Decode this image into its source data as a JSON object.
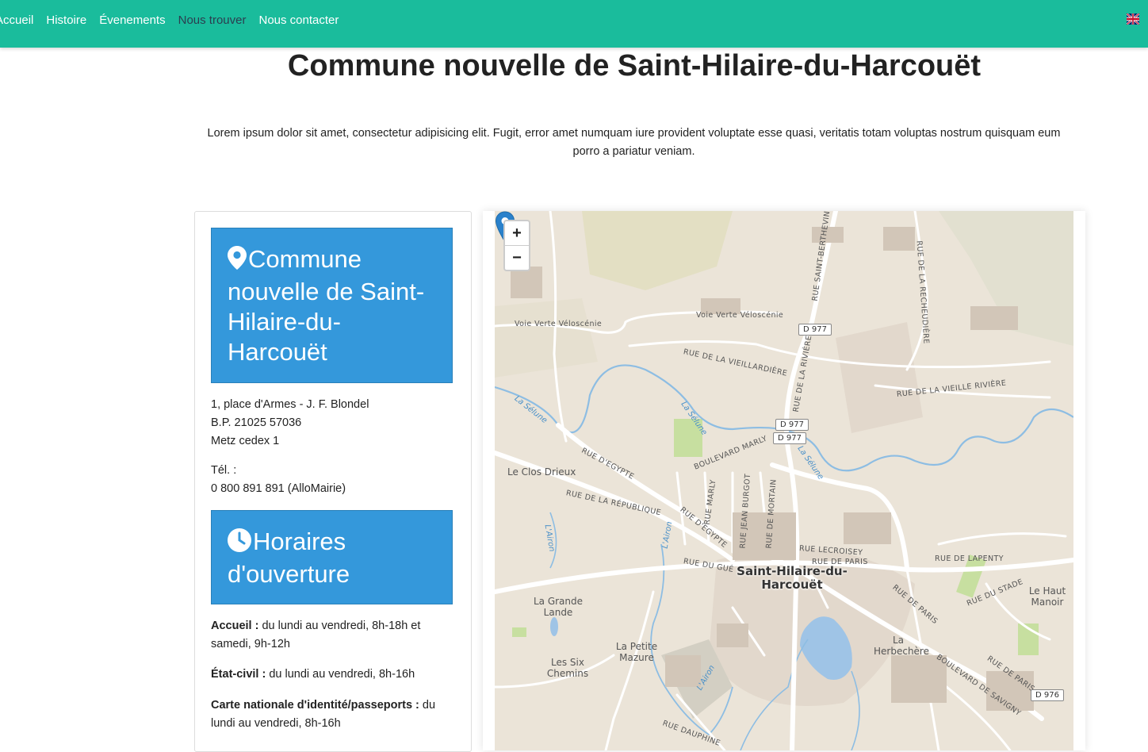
{
  "nav": {
    "items": [
      {
        "label": "Accueil"
      },
      {
        "label": "Histoire"
      },
      {
        "label": "Évenements"
      },
      {
        "label": "Nous trouver"
      },
      {
        "label": "Nous contacter"
      }
    ],
    "active_color": "#2c3e50",
    "bar_color": "#1abc9c",
    "language_flag": "uk-flag-icon"
  },
  "page": {
    "title": "Commune nouvelle de Saint-Hilaire-du-Harcouët",
    "intro": "Lorem ipsum dolor sit amet, consectetur adipisicing elit. Fugit, error amet numquam iure provident voluptate esse quasi, veritatis totam voluptas nostrum quisquam eum porro a pariatur veniam."
  },
  "card": {
    "heading": "Commune nouvelle de Saint-Hilaire-du-Harcouët",
    "heading_icon": "map-marker-icon",
    "address": [
      "1, place d'Armes - J. F. Blondel",
      "B.P. 21025 57036",
      "Metz cedex 1"
    ],
    "phone_label": "Tél. :",
    "phone": "0 800 891 891 (AlloMairie)",
    "hours_heading": "Horaires d'ouverture",
    "hours_icon": "clock-icon",
    "hours": [
      {
        "label": "Accueil :",
        "value": " du lundi au vendredi, 8h-18h et samedi, 9h-12h"
      },
      {
        "label": "État-civil :",
        "value": " du lundi au vendredi, 8h-16h"
      },
      {
        "label": "Carte nationale d'identité/passeports :",
        "value": " du lundi au vendredi, 8h-16h"
      }
    ],
    "accent_color": "#3498db"
  },
  "map": {
    "zoom_in": "+",
    "zoom_out": "−",
    "town": "Saint-Hilaire-du-Harcouët",
    "streets": {
      "s1": "Voie Verte Véloscénie",
      "s2": "Voie Verte Véloscénie",
      "s3": "RUE DE LA VIEILLARDIÈRE",
      "s4": "RUE DE LA VIEILLE RIVIÈRE",
      "s5": "RUE D'EGYPTE",
      "s6": "RUE DE LA RÉPUBLIQUE",
      "s7": "BOULEVARD MARLY",
      "s8": "RUE LECROISEY",
      "s9": "RUE DE PARIS",
      "s10": "RUE DE LAPENTY",
      "s11": "RUE DU STADE",
      "s12": "RUE DE PARIS",
      "s13": "BOULEVARD DE SAVIGNY",
      "s14": "RUE DE PARIS",
      "s15": "RUE DU GUÉ",
      "s16": "RUE SAINT-BERTHEVIN",
      "s17": "RUE DE LA RECHEUDIÈRE",
      "s18": "RUE DE LA RIVIÈRE",
      "s19": "RUE DE MORTAIN",
      "s20": "RUE JEAN BURGOT",
      "s21": "RUE MARLY",
      "s22": "RUE D'EGYPTE",
      "s23": "RUE DAUPHINE"
    },
    "roads": {
      "r1": "D 977",
      "r2": "D 977",
      "r3": "D 977",
      "r4": "D 976"
    },
    "waters": {
      "w1": "La Sélune",
      "w2": "La Sélune",
      "w3": "La Sélune",
      "w4": "L'Airon",
      "w5": "L'Airon",
      "w6": "L'Airon"
    },
    "places": {
      "p1": "Le Clos Drieux",
      "p2": "La Grande Lande",
      "p3": "La Petite Mazure",
      "p4": "Les Six Chemins",
      "p5": "La Herbechère",
      "p6": "Le Haut Manoir"
    },
    "marker_icon": "map-pin-icon"
  }
}
